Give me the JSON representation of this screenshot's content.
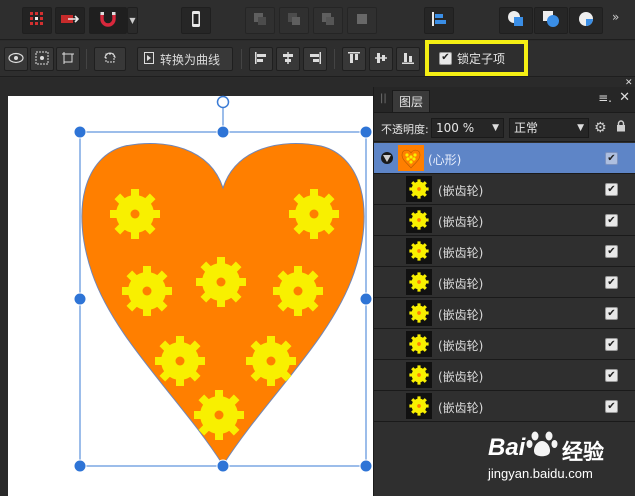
{
  "toolbar": {
    "convert_to_curves_label": "转换为曲线",
    "lock_children_label": "锁定子项",
    "lock_children_checked": true,
    "more_label": "»"
  },
  "layers_panel": {
    "tab_label": "图层",
    "opacity_label": "不透明度:",
    "opacity_value": "100 %",
    "blend_mode_value": "正常",
    "layers": [
      {
        "name": "(心形)",
        "type": "heart",
        "selected": true,
        "expanded": true,
        "visible": true
      },
      {
        "name": "(嵌齿轮)",
        "type": "gear",
        "selected": false,
        "visible": true
      },
      {
        "name": "(嵌齿轮)",
        "type": "gear",
        "selected": false,
        "visible": true
      },
      {
        "name": "(嵌齿轮)",
        "type": "gear",
        "selected": false,
        "visible": true
      },
      {
        "name": "(嵌齿轮)",
        "type": "gear",
        "selected": false,
        "visible": true
      },
      {
        "name": "(嵌齿轮)",
        "type": "gear",
        "selected": false,
        "visible": true
      },
      {
        "name": "(嵌齿轮)",
        "type": "gear",
        "selected": false,
        "visible": true
      },
      {
        "name": "(嵌齿轮)",
        "type": "gear",
        "selected": false,
        "visible": true
      },
      {
        "name": "(嵌齿轮)",
        "type": "gear",
        "selected": false,
        "visible": true
      }
    ]
  },
  "canvas": {
    "heart_color": "#ff7f00",
    "gear_color": "#f8f000",
    "gear_hole_color": "#ff7f00",
    "selection_color": "#3a7bd5"
  },
  "watermark": {
    "brand_left": "Bai",
    "brand_right": "经验",
    "url": "jingyan.baidu.com"
  }
}
